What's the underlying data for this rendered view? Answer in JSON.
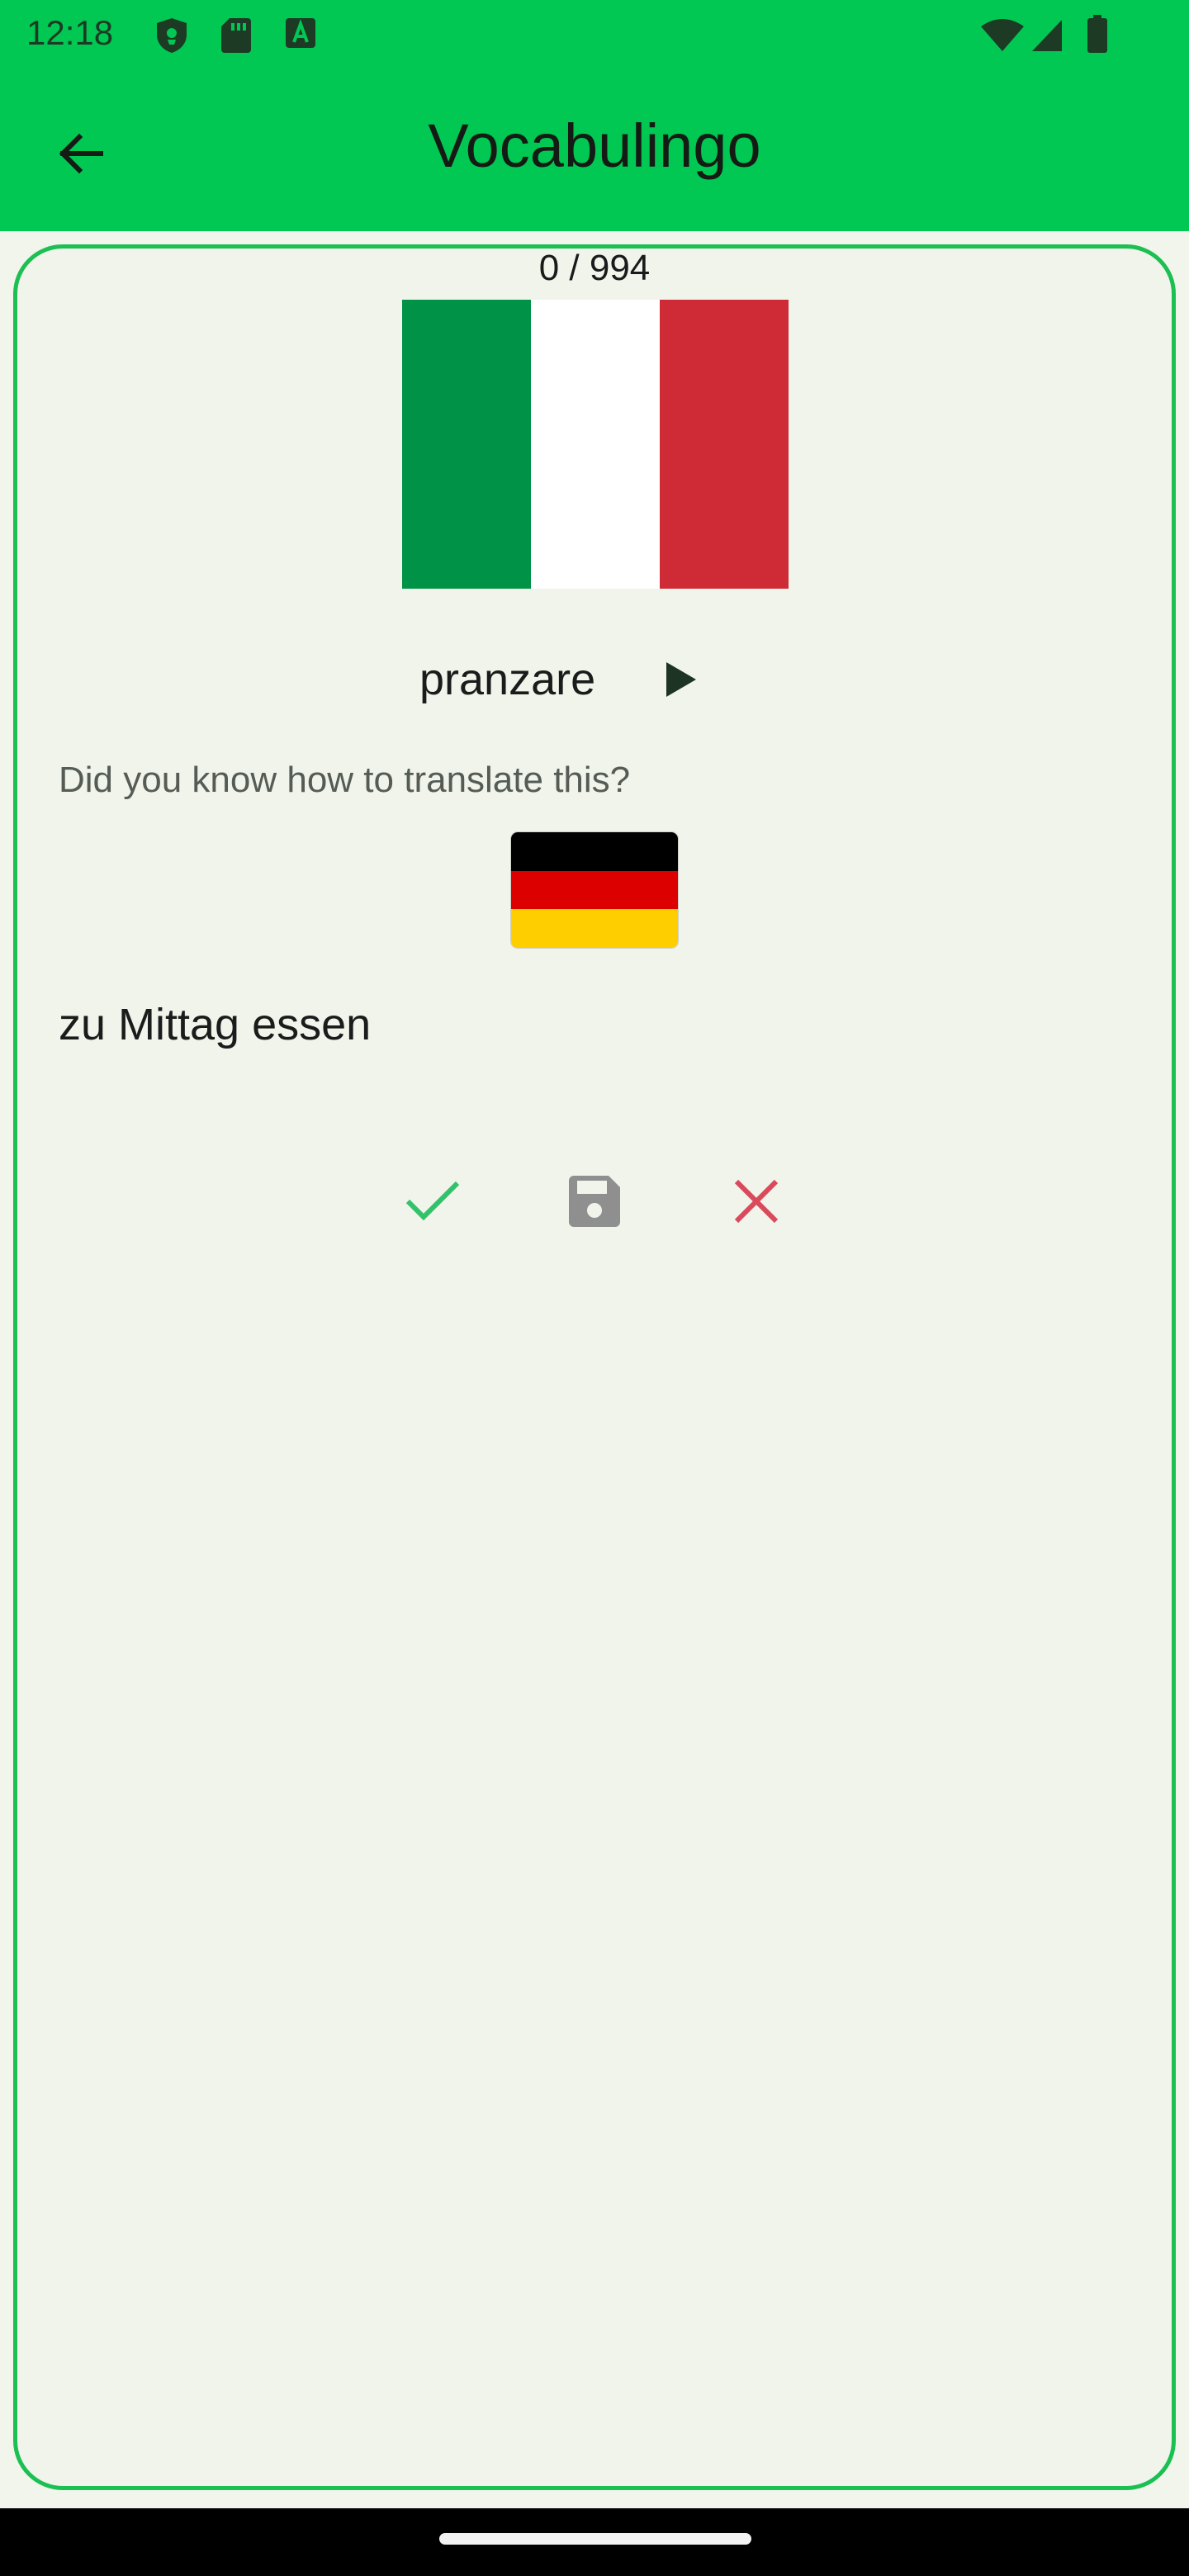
{
  "status_bar": {
    "time": "12:18",
    "left_icons": [
      "shield-icon",
      "sd-card-icon",
      "font-a-icon"
    ],
    "right_icons": [
      "wifi-icon",
      "signal-icon",
      "battery-icon"
    ]
  },
  "app_bar": {
    "title": "Vocabulingo",
    "back_icon": "arrow-back-icon"
  },
  "card": {
    "progress": "0 / 994",
    "source_flag": {
      "country": "Italy",
      "colors": [
        "#009246",
        "#FFFFFF",
        "#CE2B37"
      ]
    },
    "word": "pranzare",
    "play_icon": "play-icon",
    "question": "Did you know how to translate this?",
    "target_flag": {
      "country": "Germany",
      "colors": [
        "#000000",
        "#DD0000",
        "#FFCE00"
      ]
    },
    "translation": "zu Mittag essen",
    "actions": [
      {
        "name": "check-icon",
        "color": "#33c26b"
      },
      {
        "name": "save-icon",
        "color": "#8f8f8f"
      },
      {
        "name": "close-icon",
        "color": "#d94a5a"
      }
    ]
  },
  "colors": {
    "accent": "#00C853",
    "card_border": "#1cbf52",
    "background": "#f1f5ec"
  }
}
